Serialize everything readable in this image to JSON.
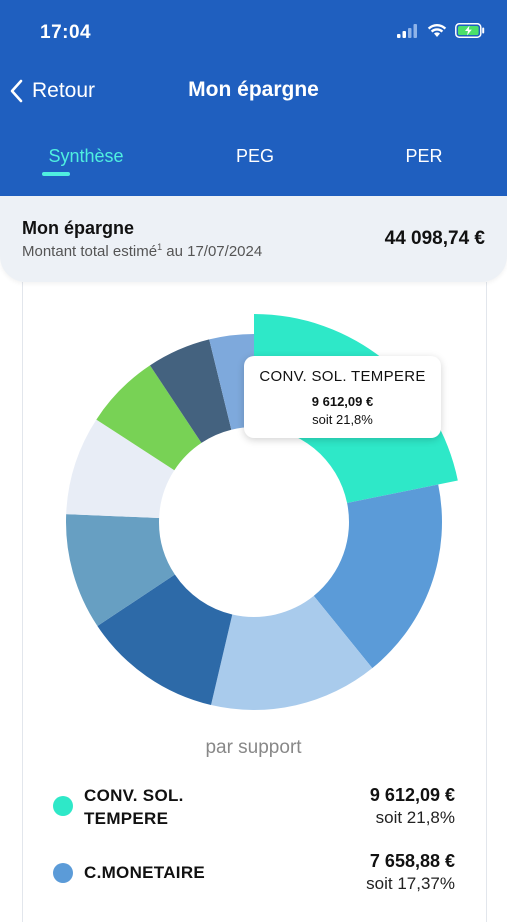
{
  "status_bar": {
    "time": "17:04",
    "icons": [
      "signal-icon",
      "wifi-icon",
      "battery-charging-icon"
    ]
  },
  "nav": {
    "back_label": "Retour",
    "title": "Mon épargne"
  },
  "tabs": [
    {
      "label": "Synthèse",
      "active": true
    },
    {
      "label": "PEG",
      "active": false
    },
    {
      "label": "PER",
      "active": false
    }
  ],
  "summary": {
    "title": "Mon épargne",
    "subtitle_prefix": "Montant total estimé",
    "footnote": "1",
    "subtitle_suffix": " au 17/07/2024",
    "amount": "44 098,74 €"
  },
  "tooltip": {
    "name": "CONV. SOL. TEMPERE",
    "amount": "9 612,09 €",
    "percent": "soit 21,8%"
  },
  "chart_data": {
    "type": "pie",
    "caption": "par support",
    "series": [
      {
        "value": 21.8,
        "color": "#2ee8c8",
        "highlighted": true
      },
      {
        "value": 17.37,
        "color": "#5b9bd8"
      },
      {
        "value": 14.5,
        "color": "#a9cbec"
      },
      {
        "value": 12.0,
        "color": "#2d6aa8"
      },
      {
        "value": 10.0,
        "color": "#679fc2"
      },
      {
        "value": 8.5,
        "color": "#e8edf6"
      },
      {
        "value": 6.5,
        "color": "#78d255"
      },
      {
        "value": 5.5,
        "color": "#44627f"
      },
      {
        "value": 3.83,
        "color": "#7ea9dc"
      }
    ]
  },
  "legend": [
    {
      "name_line1": "CONV. SOL.",
      "name_line2": "TEMPERE",
      "amount": "9 612,09 €",
      "percent": "soit 21,8%",
      "color": "#2ee8c8"
    },
    {
      "name_line1": "C.MONETAIRE",
      "name_line2": "",
      "amount": "7 658,88 €",
      "percent": "soit 17,37%",
      "color": "#5b9bd8"
    }
  ]
}
